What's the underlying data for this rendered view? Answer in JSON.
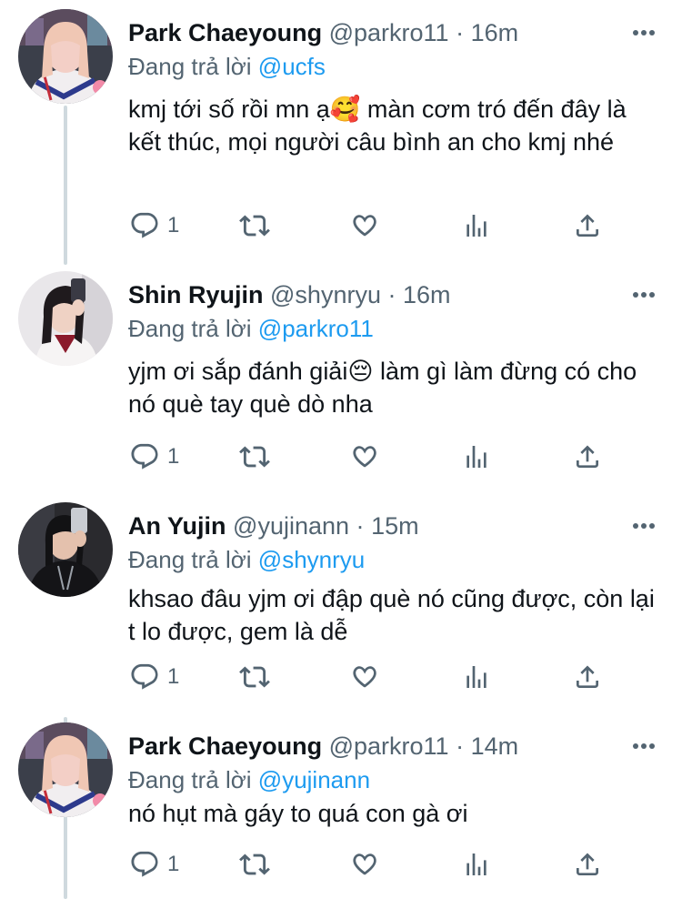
{
  "tweets": [
    {
      "name": "Park Chaeyoung",
      "handle": "@parkro11",
      "dot": "·",
      "time": "16m",
      "reply_prefix": "Đang trả lời",
      "reply_to": "@ucfs",
      "text": "kmj tới số rồi mn ạ🥰  màn cơm tró đến đây là kết thúc, mọi người câu bình an cho kmj nhé",
      "reply_count": "1"
    },
    {
      "name": "Shin Ryujin",
      "handle": "@shynryu",
      "dot": "·",
      "time": "16m",
      "reply_prefix": "Đang trả lời",
      "reply_to": "@parkro11",
      "text": "yjm ơi sắp đánh giải😔  làm gì làm đừng có cho nó què tay què dò nha",
      "reply_count": "1"
    },
    {
      "name": "An Yujin",
      "handle": "@yujinann",
      "dot": "·",
      "time": "15m",
      "reply_prefix": "Đang trả lời",
      "reply_to": "@shynryu",
      "text": "khsao đâu yjm ơi đập què nó cũng được, còn lại t lo được, gem là dễ",
      "reply_count": "1"
    },
    {
      "name": "Park Chaeyoung",
      "handle": "@parkro11",
      "dot": "·",
      "time": "14m",
      "reply_prefix": "Đang trả lời",
      "reply_to": "@yujinann",
      "text": "nó hụt mà gáy to quá con gà ơi",
      "reply_count": "1"
    }
  ],
  "icons": {
    "reply": "reply-icon",
    "retweet": "retweet-icon",
    "like": "like-icon",
    "views": "views-icon",
    "share": "share-icon",
    "more": "more-icon"
  },
  "colors": {
    "text": "#0f1419",
    "secondary": "#536471",
    "accent": "#1d9bf0",
    "thread_line": "#cfd9de"
  }
}
